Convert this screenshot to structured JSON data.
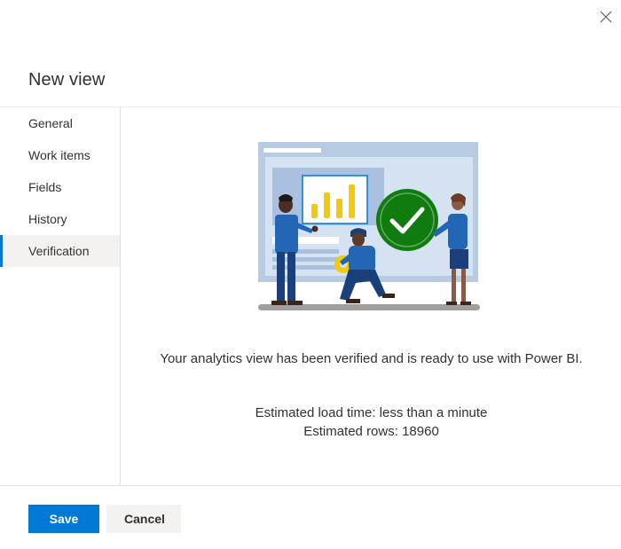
{
  "dialog": {
    "title": "New view",
    "close_icon": "close-icon"
  },
  "nav": {
    "items": [
      {
        "label": "General",
        "selected": false
      },
      {
        "label": "Work items",
        "selected": false
      },
      {
        "label": "Fields",
        "selected": false
      },
      {
        "label": "History",
        "selected": false
      },
      {
        "label": "Verification",
        "selected": true
      }
    ]
  },
  "verification": {
    "illustration": "analytics-verified-illustration",
    "message": "Your analytics view has been verified and is ready to use with Power BI.",
    "load_time": "Estimated load time: less than a minute",
    "rows": "Estimated rows: 18960"
  },
  "footer": {
    "save_label": "Save",
    "cancel_label": "Cancel"
  },
  "colors": {
    "accent": "#0078d4",
    "success": "#107c10",
    "chart_bar": "#f2c811"
  }
}
